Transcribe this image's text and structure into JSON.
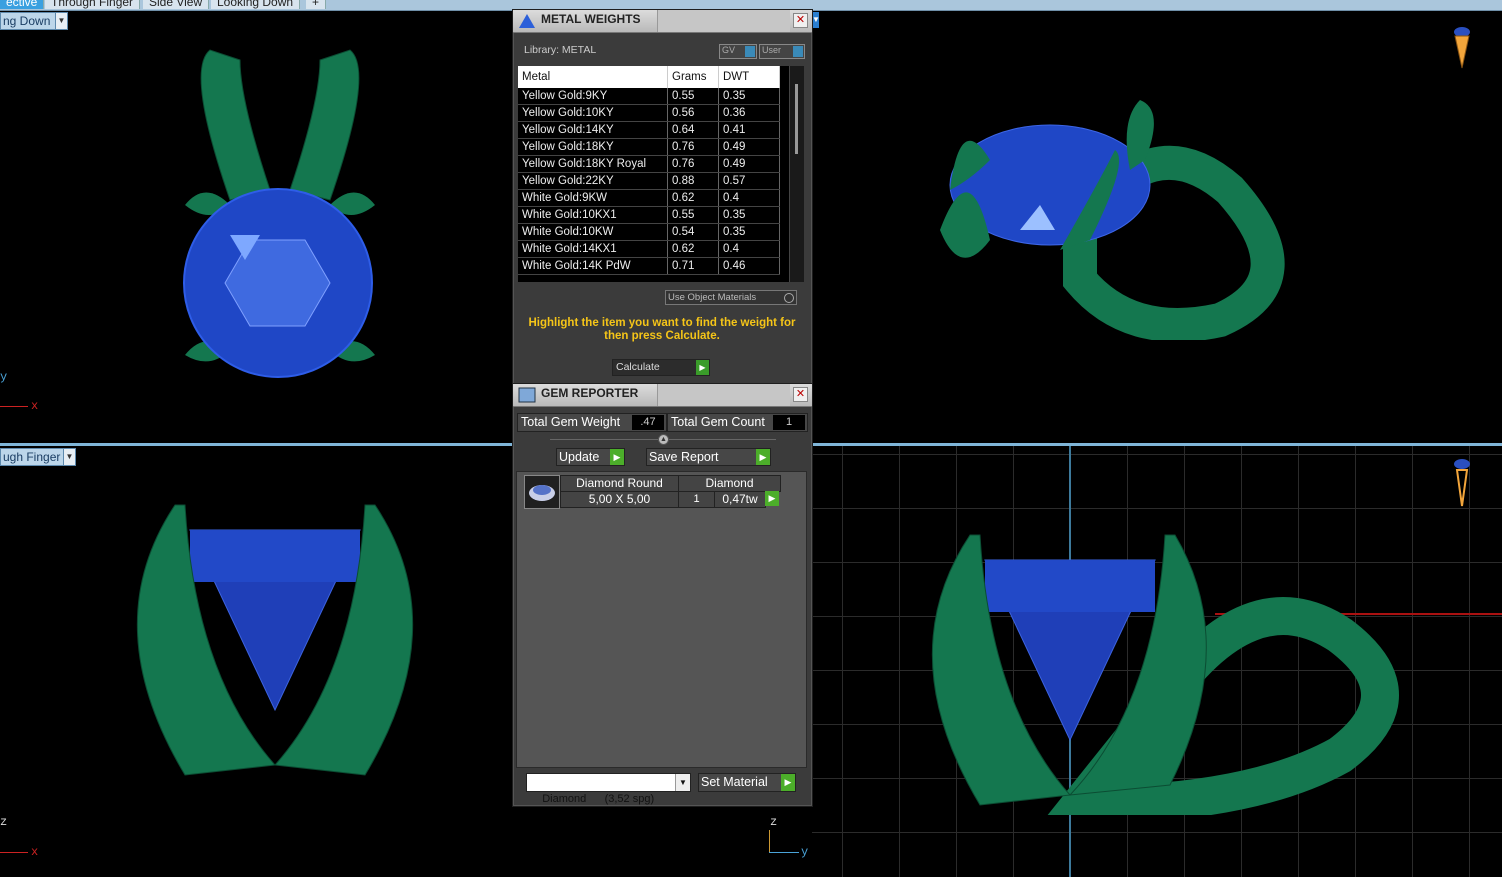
{
  "top_tabs": [
    "ective",
    "Through Finger",
    "Side View",
    "Looking Down",
    "+"
  ],
  "viewports": {
    "top_left_view": "ng Down",
    "bottom_left_view": "ugh Finger"
  },
  "axes": {
    "tl": [
      "y",
      "x"
    ],
    "bl": [
      "z",
      "x"
    ],
    "br": [
      "z",
      "y"
    ]
  },
  "metal_weights": {
    "title": "METAL WEIGHTS",
    "library_label": "Library: METAL",
    "gv_label": "GV",
    "user_label": "User",
    "columns": [
      "Metal",
      "Grams",
      "DWT"
    ],
    "rows": [
      [
        "Yellow Gold:9KY",
        "0.55",
        "0.35"
      ],
      [
        "Yellow Gold:10KY",
        "0.56",
        "0.36"
      ],
      [
        "Yellow Gold:14KY",
        "0.64",
        "0.41"
      ],
      [
        "Yellow Gold:18KY",
        "0.76",
        "0.49"
      ],
      [
        "Yellow Gold:18KY Royal",
        "0.76",
        "0.49"
      ],
      [
        "Yellow Gold:22KY",
        "0.88",
        "0.57"
      ],
      [
        "White Gold:9KW",
        "0.62",
        "0.4"
      ],
      [
        "White Gold:10KX1",
        "0.55",
        "0.35"
      ],
      [
        "White Gold:10KW",
        "0.54",
        "0.35"
      ],
      [
        "White Gold:14KX1",
        "0.62",
        "0.4"
      ],
      [
        "White Gold:14K PdW",
        "0.71",
        "0.46"
      ]
    ],
    "use_object_materials": "Use Object Materials",
    "hint": "Highlight the item you want to find the weight for then press Calculate.",
    "calculate": "Calculate"
  },
  "gem_reporter": {
    "title": "GEM REPORTER",
    "total_weight_label": "Total Gem Weight",
    "total_weight_value": ".47",
    "total_count_label": "Total Gem Count",
    "total_count_value": "1",
    "update": "Update",
    "save_report": "Save Report",
    "gem": {
      "shape": "Diamond Round",
      "material": "Diamond",
      "size": "5,00 X 5,00",
      "count": "1",
      "weight": "0,47tw"
    },
    "material_select": "Diamond      (3,52 spg)",
    "set_material": "Set Material"
  }
}
